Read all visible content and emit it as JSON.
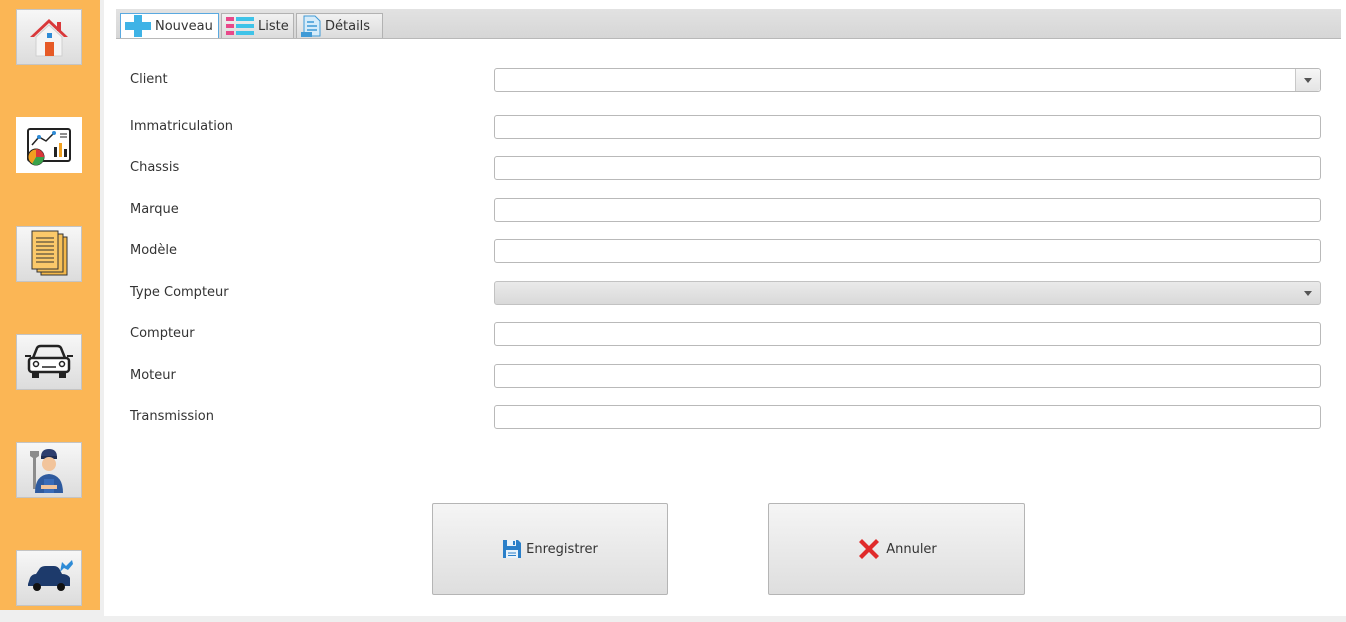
{
  "sidebar": {
    "items": [
      {
        "icon": "home-icon"
      },
      {
        "icon": "dashboard-chart-icon"
      },
      {
        "icon": "documents-icon"
      },
      {
        "icon": "car-icon"
      },
      {
        "icon": "mechanic-icon"
      },
      {
        "icon": "car-repair-icon"
      }
    ],
    "accent": "#fbb655"
  },
  "tabs": [
    {
      "label": "Nouveau",
      "icon": "plus-icon",
      "selected": true
    },
    {
      "label": "Liste",
      "icon": "list-icon",
      "selected": false
    },
    {
      "label": "Détails",
      "icon": "details-icon",
      "selected": false
    }
  ],
  "form": {
    "client": {
      "label": "Client",
      "value": ""
    },
    "immatriculation": {
      "label": "Immatriculation",
      "value": ""
    },
    "chassis": {
      "label": "Chassis",
      "value": ""
    },
    "marque": {
      "label": "Marque",
      "value": ""
    },
    "modele": {
      "label": "Modèle",
      "value": ""
    },
    "type_compteur": {
      "label": "Type Compteur",
      "value": ""
    },
    "compteur": {
      "label": "Compteur",
      "value": ""
    },
    "moteur": {
      "label": "Moteur",
      "value": ""
    },
    "transmission": {
      "label": "Transmission",
      "value": ""
    }
  },
  "actions": {
    "save_label": "Enregistrer",
    "cancel_label": "Annuler"
  }
}
